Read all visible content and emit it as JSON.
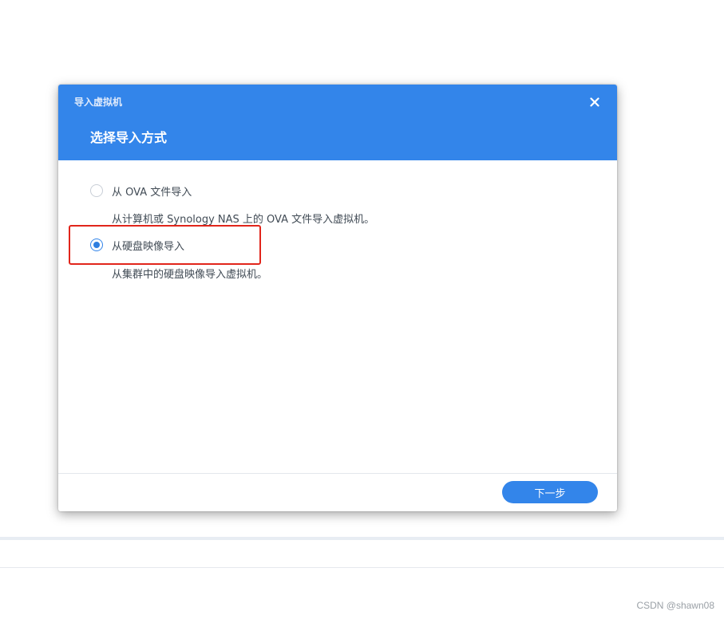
{
  "dialog": {
    "window_title": "导入虚拟机",
    "step_title": "选择导入方式",
    "close_icon": "close-icon",
    "options": [
      {
        "label": "从 OVA 文件导入",
        "description": "从计算机或 Synology NAS 上的 OVA 文件导入虚拟机。",
        "selected": false
      },
      {
        "label": "从硬盘映像导入",
        "description": "从集群中的硬盘映像导入虚拟机。",
        "selected": true
      }
    ],
    "next_button_label": "下一步"
  },
  "watermark": "CSDN @shawn08",
  "colors": {
    "header": "#3385ea",
    "accent": "#2f7fe0",
    "highlight": "#e1251b",
    "text": "#414b55"
  }
}
